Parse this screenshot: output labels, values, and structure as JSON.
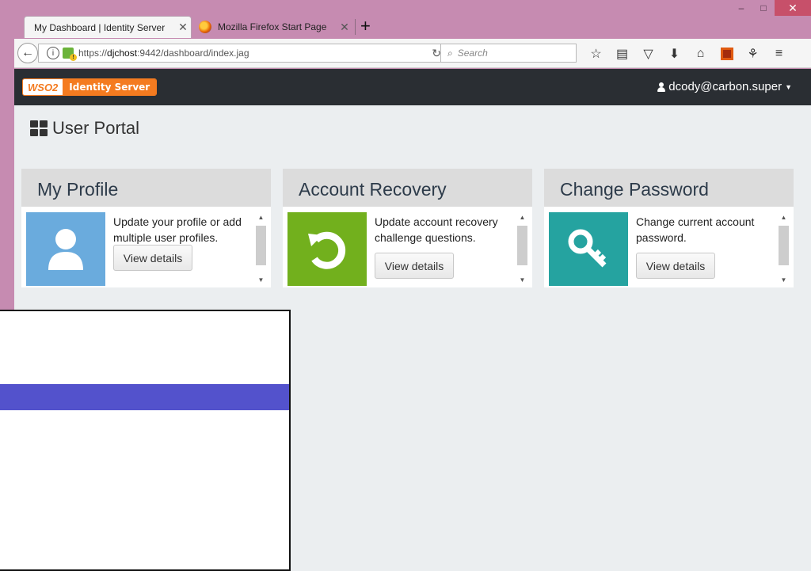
{
  "browser": {
    "tabs": [
      {
        "title": "My Dashboard | Identity Server",
        "close": "✕"
      },
      {
        "title": "Mozilla Firefox Start Page",
        "close": "✕"
      }
    ],
    "new_tab": "+",
    "window_controls": {
      "minimize": "–",
      "maximize": "□",
      "close": "✕"
    },
    "url_prefix": "https://",
    "url_host": "djchost",
    "url_rest": ":9442/dashboard/index.jag",
    "search_placeholder": "Search",
    "toolbar_icons": [
      "bookmark-star-icon",
      "reader-list-icon",
      "pocket-icon",
      "download-icon",
      "home-icon",
      "extension-icon",
      "puzzle-icon",
      "menu-icon"
    ]
  },
  "app": {
    "logo_left": "WSO2",
    "logo_right": "Identity Server",
    "user": "dcody@carbon.super",
    "portal_title": "User Portal"
  },
  "cards": [
    {
      "title": "My Profile",
      "description": "Update your profile or add multiple user profiles.",
      "button": "View details",
      "tile_color": "#6aabdd",
      "icon": "user-icon"
    },
    {
      "title": "Account Recovery",
      "description": "Update account recovery challenge questions.",
      "button": "View details",
      "tile_color": "#72b01d",
      "icon": "recovery-icon"
    },
    {
      "title": "Change Password",
      "description": "Change current account password.",
      "button": "View details",
      "tile_color": "#25a3a0",
      "icon": "key-icon"
    }
  ],
  "colors": {
    "header_bg": "#2a2e33",
    "brand_orange": "#f47b20",
    "overlay_bar": "#5352cc"
  }
}
